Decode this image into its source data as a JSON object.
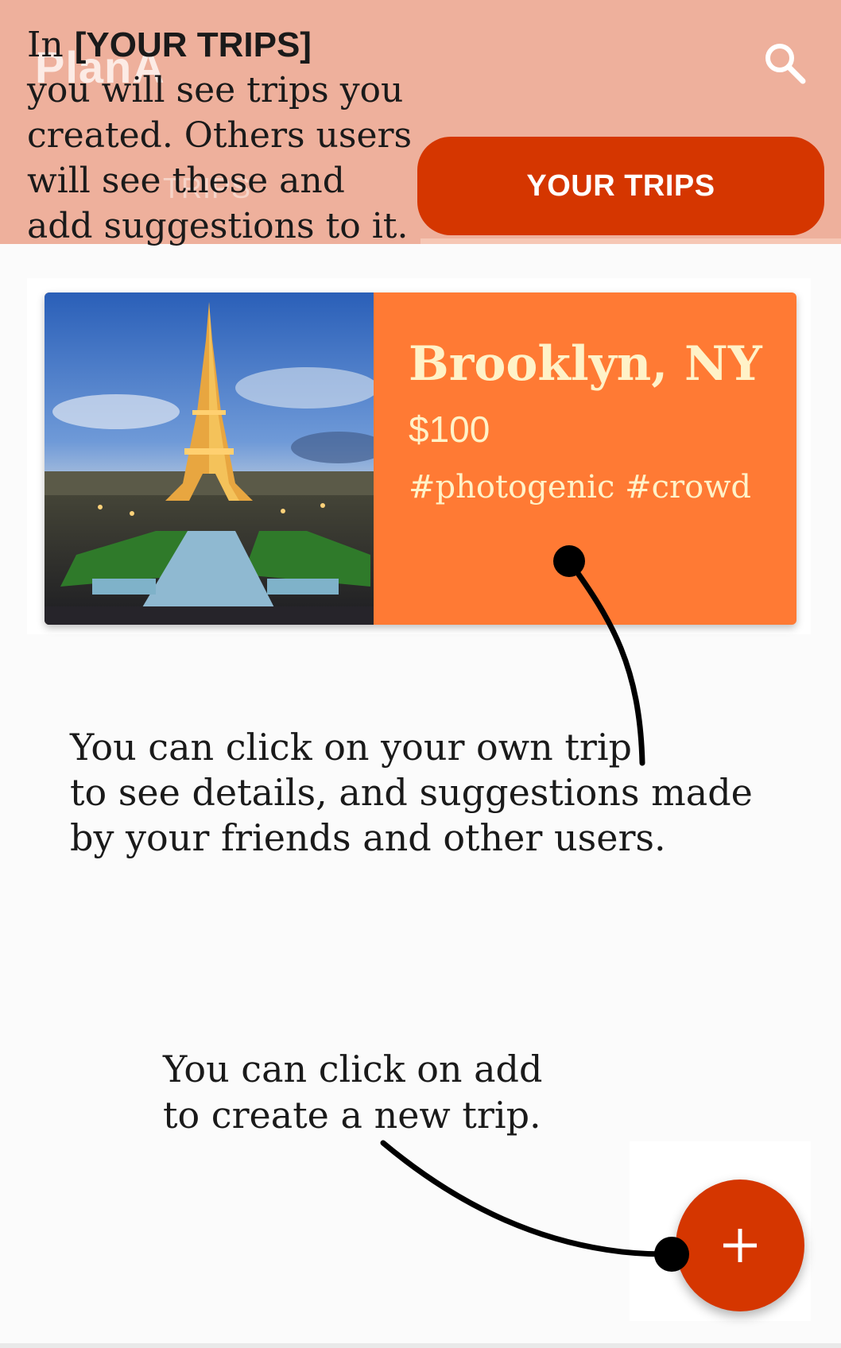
{
  "app": {
    "title": "PlanA",
    "search_icon": "search-icon"
  },
  "tabs": [
    {
      "label": "TRIPS",
      "selected": false
    },
    {
      "label": "YOUR TRIPS",
      "selected": true
    }
  ],
  "tour": {
    "top_prefix": "In ",
    "top_highlight": "[YOUR TRIPS]",
    "top_lines": [
      "you will see trips you",
      "created. Others users",
      "will see these and",
      "add suggestions to it."
    ],
    "mid_lines": [
      "You can click on your own trip",
      "to see details, and suggestions made",
      "by your friends and other users."
    ],
    "bottom_lines": [
      "You can click on add",
      "to create a new trip."
    ]
  },
  "trip": {
    "image_icon": "eiffel-tower-photo",
    "title": "Brooklyn, NY",
    "price": "$100",
    "tags": "#photogenic #crowd"
  },
  "fab": {
    "icon": "plus-icon"
  },
  "colors": {
    "appbar": "#eeb09c",
    "accent": "#d53600",
    "card": "#ff7a34",
    "card_text": "#fff2c8"
  }
}
